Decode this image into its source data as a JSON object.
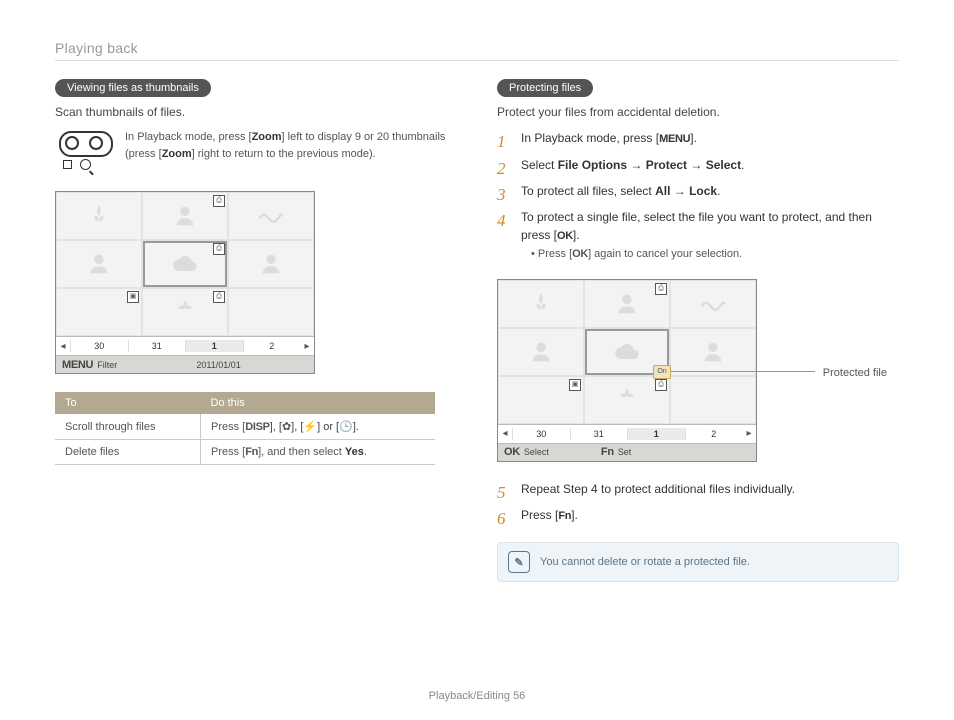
{
  "header": {
    "title": "Playing back"
  },
  "left": {
    "pill": "Viewing files as thumbnails",
    "lead": "Scan thumbnails of files.",
    "zoomtext_a": "In Playback mode, press [",
    "zoomtext_zoom1": "Zoom",
    "zoomtext_b": "] left to display 9 or 20 thumbnails (press [",
    "zoomtext_zoom2": "Zoom",
    "zoomtext_c": "] right to return to the previous mode).",
    "panel": {
      "dates": [
        "30",
        "31",
        "1",
        "2"
      ],
      "filter_label": "Filter",
      "date_text": "2011/01/01",
      "menu_label": "MENU"
    },
    "table": {
      "h1": "To",
      "h2": "Do this",
      "r1c1": "Scroll through files",
      "r1c2_a": "Press [",
      "r1_disp": "DISP",
      "r1c2_b": "], [",
      "r1_g2": "✿",
      "r1c2_c": "], [",
      "r1_g3": "⚡",
      "r1c2_d": "] or [",
      "r1_g4": "🕒",
      "r1c2_e": "].",
      "r2c1": "Delete files",
      "r2c2_a": "Press [",
      "r2_fn": "Fn",
      "r2c2_b": "], and then select ",
      "r2_yes": "Yes",
      "r2c2_c": "."
    }
  },
  "right": {
    "pill": "Protecting files",
    "lead": "Protect your files from accidental deletion.",
    "steps": {
      "s1_a": "In Playback mode, press [",
      "s1_menu": "MENU",
      "s1_b": "].",
      "s2_a": "Select ",
      "s2_b1": "File Options",
      "s2_arr1": " → ",
      "s2_b2": "Protect",
      "s2_arr2": " → ",
      "s2_b3": "Select",
      "s2_c": ".",
      "s3_a": "To protect all files, select ",
      "s3_b1": "All",
      "s3_arr": " → ",
      "s3_b2": "Lock",
      "s3_c": ".",
      "s4_a": "To protect a single file, select the file you want to protect, and then press [",
      "s4_ok": "OK",
      "s4_b": "].",
      "s4_sub_a": "Press [",
      "s4_sub_ok": "OK",
      "s4_sub_b": "] again to cancel your selection.",
      "s5": "Repeat Step 4 to protect additional files individually.",
      "s6_a": "Press [",
      "s6_fn": "Fn",
      "s6_b": "]."
    },
    "callout": "Protected file",
    "panel": {
      "dates": [
        "30",
        "31",
        "1",
        "2"
      ],
      "ok_label": "OK",
      "select_label": "Select",
      "fn_label": "Fn",
      "set_label": "Set",
      "lock_text": "On"
    },
    "note": "You cannot delete or rotate a protected file."
  },
  "footer": {
    "section": "Playback/Editing",
    "page": "56"
  }
}
